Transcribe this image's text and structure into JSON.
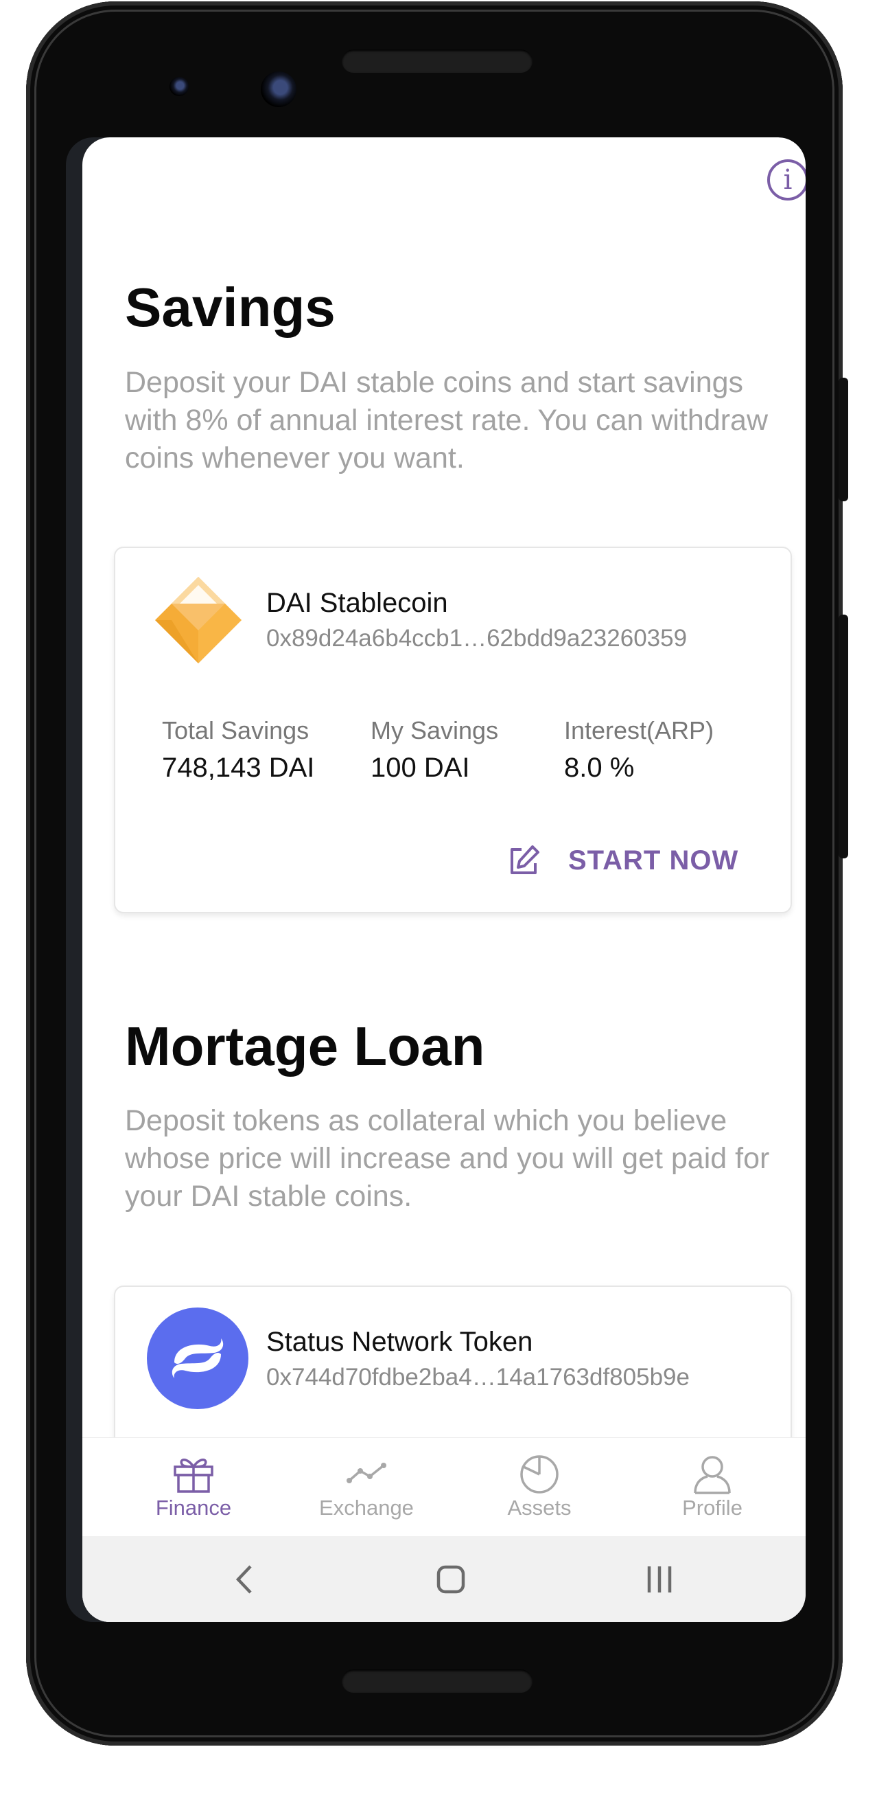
{
  "savings": {
    "title": "Savings",
    "description": "Deposit your DAI stable coins and start savings with 8% of annual interest rate. You can withdraw coins whenever you want.",
    "token": {
      "name": "DAI Stablecoin",
      "address": "0x89d24a6b4ccb1…62bdd9a23260359",
      "icon": "dai-logo-icon"
    },
    "stats": [
      {
        "label": "Total Savings",
        "value": "748,143 DAI"
      },
      {
        "label": "My Savings",
        "value": "100 DAI"
      },
      {
        "label": "Interest(ARP)",
        "value": "8.0 %"
      }
    ],
    "action_label": "START NOW"
  },
  "loan": {
    "title": "Mortage Loan",
    "description": "Deposit tokens as collateral which you believe whose price will increase and you will get paid for your DAI stable coins.",
    "token": {
      "name": "Status Network Token",
      "address": "0x744d70fdbe2ba4…14a1763df805b9e",
      "icon": "status-network-logo-icon"
    }
  },
  "info_icon": "i",
  "bottom_nav": [
    {
      "label": "Finance",
      "icon": "gift-icon",
      "active": true
    },
    {
      "label": "Exchange",
      "icon": "line-chart-icon",
      "active": false
    },
    {
      "label": "Assets",
      "icon": "pie-chart-icon",
      "active": false
    },
    {
      "label": "Profile",
      "icon": "user-icon",
      "active": false
    }
  ],
  "system_nav": [
    "back-icon",
    "home-icon",
    "recents-icon"
  ],
  "colors": {
    "accent": "#7b5ea7",
    "dai_orange": "#f5ac37",
    "status_blue": "#5b6dee",
    "muted_text": "#a2a2a2"
  }
}
